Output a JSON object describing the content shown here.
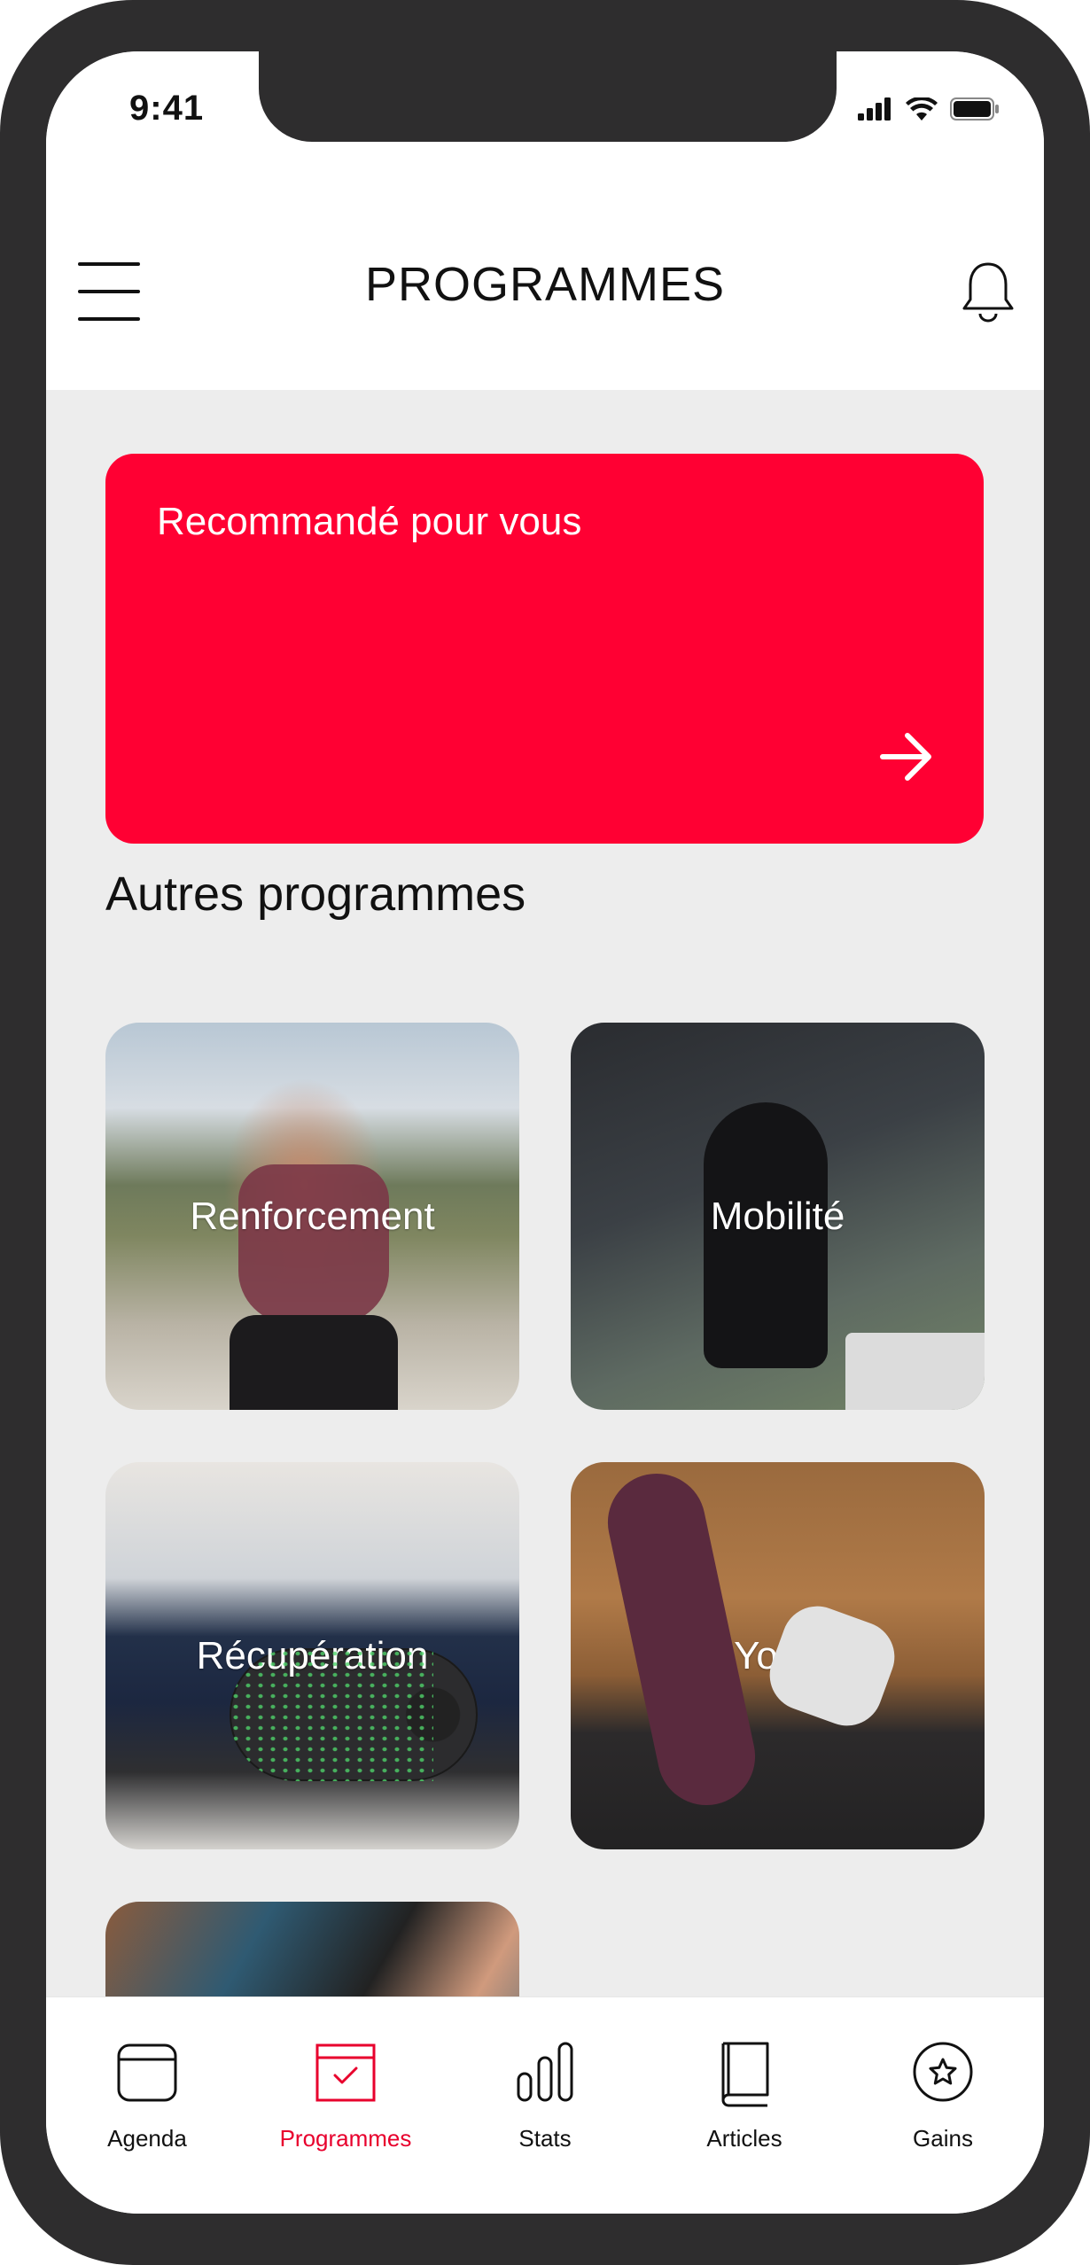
{
  "status_bar": {
    "time": "9:41"
  },
  "header": {
    "title": "PROGRAMMES"
  },
  "recommended": {
    "title": "Recommandé pour vous"
  },
  "other_programs": {
    "title": "Autres programmes",
    "items": [
      {
        "label": "Renforcement"
      },
      {
        "label": "Mobilité"
      },
      {
        "label": "Récupération"
      },
      {
        "label": "Yoga"
      },
      {
        "label": ""
      }
    ]
  },
  "tabbar": {
    "active": "Programmes",
    "items": [
      {
        "label": "Agenda",
        "icon": "calendar-icon"
      },
      {
        "label": "Programmes",
        "icon": "checkbox-icon"
      },
      {
        "label": "Stats",
        "icon": "bar-chart-icon"
      },
      {
        "label": "Articles",
        "icon": "book-icon"
      },
      {
        "label": "Gains",
        "icon": "star-badge-icon"
      }
    ]
  },
  "colors": {
    "accent": "#ff0033",
    "active_tab": "#e8002d",
    "background": "#ededed",
    "phone_frame": "#2e2d2e"
  }
}
